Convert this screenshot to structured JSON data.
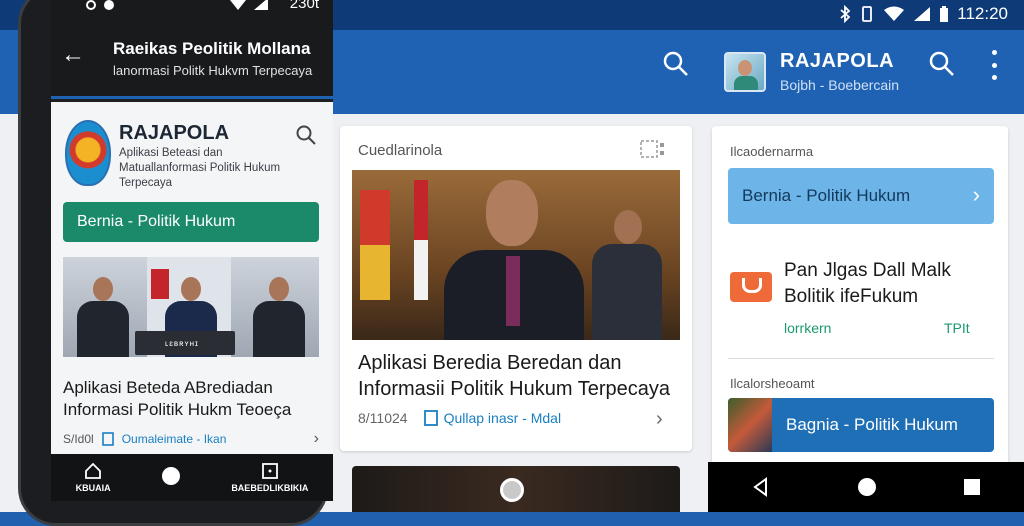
{
  "status_bar": {
    "time": "112:20",
    "phone_time": "230t"
  },
  "app_bar": {
    "profile_name": "RAJAPOLA",
    "profile_subtitle": "Bojbh - Boebercain"
  },
  "phone": {
    "header_title": "Raeikas Peolitik Mollana",
    "header_subtitle": "lanormasi Politk Hukvm Terpecaya",
    "brand": "RAJAPOLA",
    "brand_desc": "Aplikasi Beteasi dan Matuallanformasi Politik Hukum Terpecaya",
    "green_button": "Bernia - Politik Hukum",
    "photo_caption": "ʟɛʙʀʏʜɪ",
    "card_title": "Aplikasi Beteda ABrediadan Informasi Politik Hukm Teoeça",
    "card_date": "S/Id0l",
    "card_tag": "Oumaleimate - Ikan",
    "nav": [
      {
        "label": "KBUAIA"
      },
      {
        "label": ""
      },
      {
        "label": "BAEBEDLIKBIKIA"
      }
    ]
  },
  "center_card": {
    "label": "Cuedlarinola",
    "title": "Aplikasi Beredia Beredan dan Informasii Politik Hukum Terpecaya",
    "date": "8/11024",
    "tag": "Qullap inasr - Mdal"
  },
  "right_card": {
    "label1": "Ilcaodernarma",
    "button1": "Bernia - Politik Hukum",
    "title": "Pan Jlgas Dall Malk Bolitik ifeFukum",
    "link1": "lorrkern",
    "link2": "TPIt",
    "label2": "Ilcalorsheoamt",
    "button2": "Bagnia - Politik Hukum"
  },
  "colors": {
    "primary": "#1f62b3",
    "accent_green": "#1a8a6a",
    "light_blue": "#6db4e8"
  }
}
